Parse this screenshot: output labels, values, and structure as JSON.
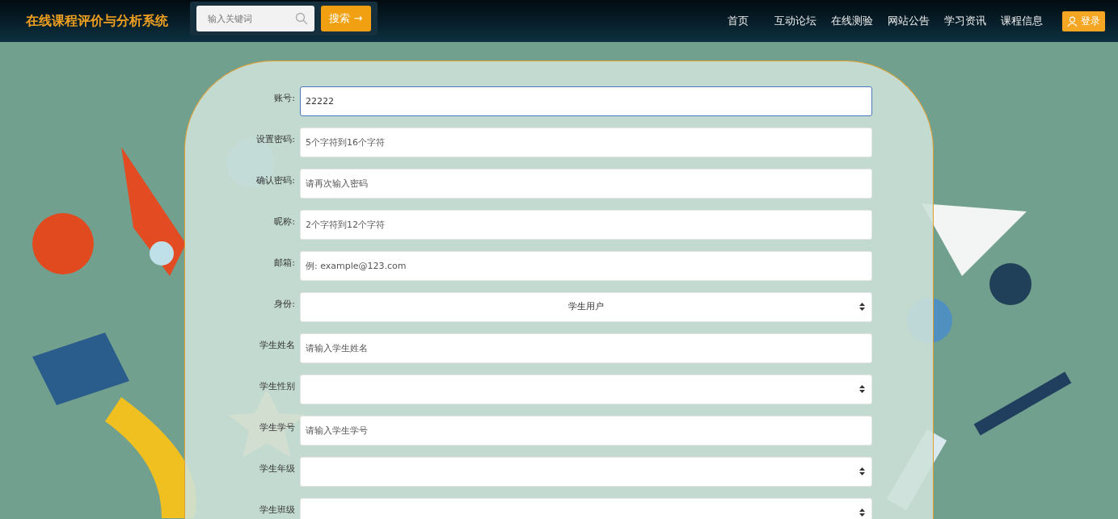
{
  "header": {
    "site_title": "在线课程评价与分析系统",
    "search": {
      "placeholder": "输入关键词"
    },
    "search_button": "搜索 →",
    "nav": [
      "首页",
      "互动论坛",
      "在线测验",
      "网站公告",
      "学习资讯",
      "课程信息"
    ],
    "login_button": "登录"
  },
  "form": {
    "fields": [
      {
        "label": "账号:",
        "kind": "input",
        "value": "22222"
      },
      {
        "label": "设置密码:",
        "kind": "input",
        "placeholder": "5个字符到16个字符"
      },
      {
        "label": "确认密码:",
        "kind": "input",
        "placeholder": "请再次输入密码"
      },
      {
        "label": "昵称:",
        "kind": "input",
        "placeholder": "2个字符到12个字符"
      },
      {
        "label": "邮箱:",
        "kind": "input",
        "placeholder": "例: example@123.com"
      },
      {
        "label": "身份:",
        "kind": "select",
        "value": "学生用户"
      },
      {
        "label": "学生姓名",
        "kind": "input",
        "placeholder": "请输入学生姓名"
      },
      {
        "label": "学生性别",
        "kind": "select"
      },
      {
        "label": "学生学号",
        "kind": "input",
        "placeholder": "请输入学生学号"
      },
      {
        "label": "学生年级",
        "kind": "select"
      },
      {
        "label": "学生班级",
        "kind": "select"
      }
    ]
  }
}
